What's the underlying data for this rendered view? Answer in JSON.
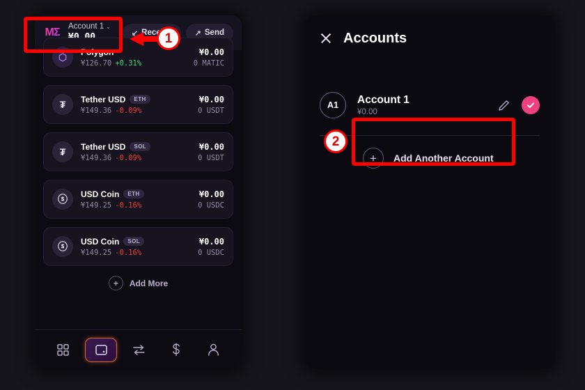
{
  "left_panel": {
    "header": {
      "logo": "metamask-logo",
      "account_name": "Account 1",
      "chevron": "⌄",
      "balance": "¥0.00",
      "receive_label": "Receive",
      "receive_icon": "↙",
      "send_label": "Send",
      "send_icon": "↗"
    },
    "tokens": [
      {
        "icon": "polygon-icon",
        "icon_glyph": "⬡",
        "name": "Polygon",
        "chain": "",
        "price": "¥126.70",
        "change": "+0.31%",
        "change_dir": "up",
        "fiat": "¥0.00",
        "amount": "0 MATIC"
      },
      {
        "icon": "tether-icon",
        "icon_glyph": "₮",
        "name": "Tether USD",
        "chain": "ETH",
        "price": "¥149.36",
        "change": "-0.09%",
        "change_dir": "down",
        "fiat": "¥0.00",
        "amount": "0 USDT"
      },
      {
        "icon": "tether-icon",
        "icon_glyph": "₮",
        "name": "Tether USD",
        "chain": "SOL",
        "price": "¥149.36",
        "change": "-0.09%",
        "change_dir": "down",
        "fiat": "¥0.00",
        "amount": "0 USDT"
      },
      {
        "icon": "usdcoin-icon",
        "icon_glyph": "ⓢ",
        "name": "USD Coin",
        "chain": "ETH",
        "price": "¥149.25",
        "change": "-0.16%",
        "change_dir": "down",
        "fiat": "¥0.00",
        "amount": "0 USDC"
      },
      {
        "icon": "usdcoin-icon",
        "icon_glyph": "ⓢ",
        "name": "USD Coin",
        "chain": "SOL",
        "price": "¥149.25",
        "change": "-0.16%",
        "change_dir": "down",
        "fiat": "¥0.00",
        "amount": "0 USDC"
      }
    ],
    "add_more": {
      "plus": "+",
      "label": "Add More"
    },
    "nav": [
      {
        "name": "dashboard",
        "icon": "grid-icon",
        "active": false
      },
      {
        "name": "wallet",
        "icon": "wallet-icon",
        "active": true
      },
      {
        "name": "swap",
        "icon": "swap-arrows-icon",
        "active": false
      },
      {
        "name": "buy",
        "icon": "dollar-icon",
        "active": false
      },
      {
        "name": "profile",
        "icon": "person-icon",
        "active": false
      }
    ]
  },
  "right_panel": {
    "close_icon": "close-icon",
    "title": "Accounts",
    "account": {
      "avatar": "A1",
      "name": "Account 1",
      "balance": "¥0.00",
      "edit_icon": "pencil-icon",
      "selected_icon": "check-icon"
    },
    "add_account": {
      "plus": "+",
      "label": "Add Another Account"
    }
  },
  "annotations": {
    "step_1": "①",
    "step_1_number": "1",
    "step_2_number": "2",
    "arrow": "left-arrow"
  },
  "colors": {
    "accent_pink": "#ef4080",
    "highlight_red": "#ff0000",
    "active_nav_border": "#e0662f",
    "positive": "#3ad47f",
    "negative": "#ef3b3b"
  }
}
